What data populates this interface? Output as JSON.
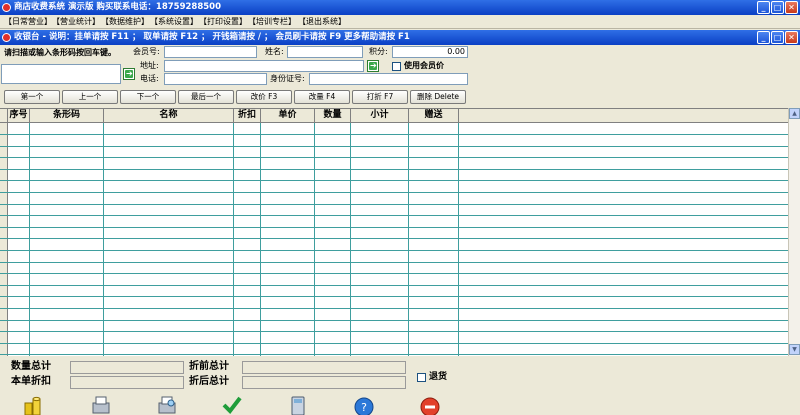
{
  "main_window": {
    "title": "商店收费系统 演示版 购买联系电话：18759288500"
  },
  "menu": [
    "【日常营业】",
    "【营业统计】",
    "【数据维护】",
    "【系统设置】",
    "【打印设置】",
    "【培训专栏】",
    "【退出系统】"
  ],
  "child_window": {
    "title": "收银台 - 说明：挂单请按 F11 ； 取单请按 F12 ； 开钱箱请按 / ； 会员刷卡请按 F9   更多帮助请按 F1"
  },
  "form": {
    "scan_prompt": "请扫描或输入条形码按回车键。",
    "member_no_label": "会员号:",
    "name_label": "姓名:",
    "points_label": "积分:",
    "points_value": "0.00",
    "address_label": "地址:",
    "use_member_price_label": "使用会员价",
    "phone_label": "电话:",
    "id_label": "身份证号:"
  },
  "nav_buttons": [
    "第一个",
    "上一个",
    "下一个",
    "最后一个",
    "改价 F3",
    "改量 F4",
    "打折 F7",
    "删除 Delete"
  ],
  "table": {
    "columns": [
      "序号",
      "条形码",
      "名称",
      "折扣",
      "单价",
      "数量",
      "小计",
      "赠送"
    ]
  },
  "summary": {
    "qty_total_label": "数量总计",
    "pre_discount_total_label": "折前总计",
    "order_discount_label": "本单折扣",
    "post_discount_total_label": "折后总计",
    "return_label": "退货"
  },
  "window_buttons": {
    "min": "_",
    "max": "□",
    "close": "✕"
  }
}
